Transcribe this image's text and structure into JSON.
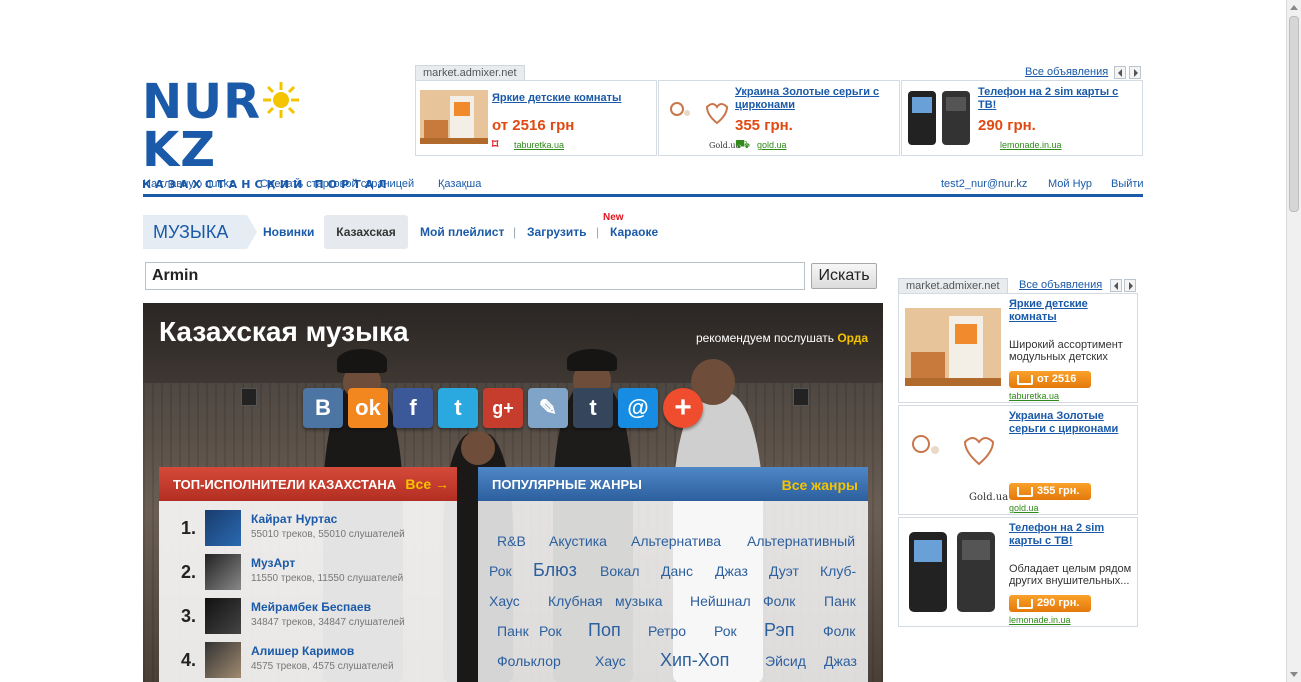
{
  "logo": {
    "left": "NUR",
    "right": "KZ",
    "tagline": "КАЗАХСТАНСКИЙ ПОРТАЛ"
  },
  "top_ads": {
    "label": "market.admixer.net",
    "all_link": "Все объявления",
    "items": [
      {
        "title": "Яркие детские комнаты",
        "price": "от 2516 грн",
        "source": "taburetka.ua"
      },
      {
        "title": "Украина Золотые серьги с цирконами",
        "price": "355 грн.",
        "source": "gold.ua",
        "brand": "Gold.ua"
      },
      {
        "title": "Телефон на 2 sim карты с ТВ!",
        "price": "290 грн.",
        "source": "lemonade.in.ua"
      }
    ]
  },
  "topnav": {
    "home": "На главную nur.kz",
    "start": "Сделать стартовой страницей",
    "kazakh": "Қазақша",
    "email": "test2_nur@nur.kz",
    "my": "Мой Нур",
    "logout": "Выйти"
  },
  "section_menu": {
    "section": "МУЗЫКА",
    "items": [
      "Новинки",
      "Казахская",
      "Мой плейлист",
      "Загрузить",
      "Караоке"
    ],
    "new_badge": "New"
  },
  "search": {
    "value": "Armin",
    "button": "Искать"
  },
  "hero": {
    "title": "Казахская музыка",
    "recommend": "рекомендуем послушать",
    "recommend_artist": "Орда"
  },
  "share_icons": [
    "В",
    "ok",
    "f",
    "t",
    "g+",
    "✎",
    "t",
    "@",
    "+"
  ],
  "top_artists": {
    "title": "ТОП-ИСПОЛНИТЕЛИ КАЗАХСТАНА",
    "all": "Все →",
    "items": [
      {
        "rank": "1.",
        "name": "Кайрат Нуртас",
        "meta": "55010 треков, 55010 слушателей"
      },
      {
        "rank": "2.",
        "name": "МузАрт",
        "meta": "11550 треков, 11550 слушателей"
      },
      {
        "rank": "3.",
        "name": "Мейрамбек Беспаев",
        "meta": "34847 треков, 34847 слушателей"
      },
      {
        "rank": "4.",
        "name": "Алишер Каримов",
        "meta": "4575 треков, 4575 слушателей"
      }
    ]
  },
  "genres": {
    "title": "ПОПУЛЯРНЫЕ ЖАНРЫ",
    "all": "Все жанры",
    "items": [
      "R&B",
      "Акустика",
      "Альтернатива",
      "Альтернативный",
      "Рок",
      "Блюз",
      "Вокал",
      "Данс",
      "Джаз",
      "Дуэт",
      "Клуб-",
      "Хаус",
      "Клубная",
      "музыка",
      "Нейшнал",
      "Фолк",
      "Панк",
      "Панк",
      "Рок",
      "Поп",
      "Ретро",
      "Рок",
      "Рэп",
      "Фолк",
      "Фольклор",
      "Хаус",
      "Хип-Хоп",
      "Эйсид",
      "Джаз"
    ]
  },
  "right_ads": {
    "label": "market.admixer.net",
    "all_link": "Все объявления",
    "items": [
      {
        "title": "Яркие детские комнаты",
        "desc": "Широкий ассортимент модульных детских",
        "price": "от 2516 грн",
        "source": "taburetka.ua"
      },
      {
        "title": "Украина Золотые серьги с цирконами",
        "desc": "",
        "price": "355 грн.",
        "source": "gold.ua",
        "brand": "Gold.ua"
      },
      {
        "title": "Телефон на 2 sim карты с ТВ!",
        "desc": "Обладает целым рядом других внушительных...",
        "price": "290 грн.",
        "source": "lemonade.in.ua"
      }
    ]
  },
  "colors": {
    "brand_blue": "#1a5aa8",
    "price_orange": "#e04a12",
    "accent_yellow": "#f5c400"
  }
}
